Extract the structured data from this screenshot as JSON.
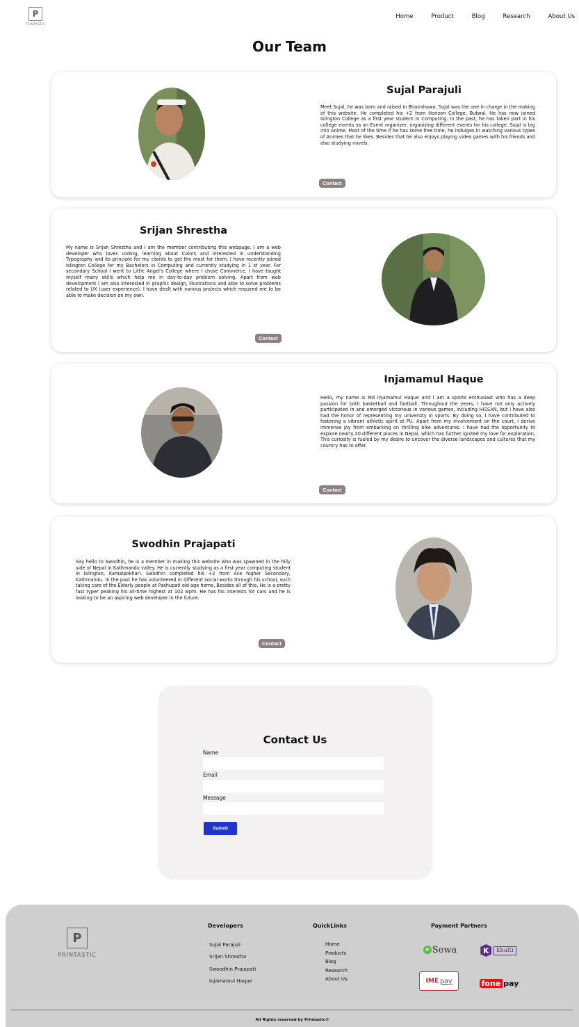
{
  "header": {
    "logo_text": "PRINTASTIC",
    "logo_mark": "P",
    "nav": [
      "Home",
      "Product",
      "Blog",
      "Research",
      "About Us"
    ]
  },
  "page_title": "Our Team",
  "team": [
    {
      "name": "Sujal Parajuli",
      "bio": "Meet Sujal, he was born and raised in Bhairahawa. Sujal was the one in charge in the making of this website. He completed his +2 from Horizon College, Butwal. He has now joined Islington College as a first year student in Computing. In the past, he has taken part in his college events as an Event organizer, organizing different events for his college. Sujal is big into Anime. Most of the time if he has some free time, he indulges in watching various types of Animes that he likes. Besides that he also enjoys playing video games with his friends and also studying novels.",
      "contact_label": "Contact"
    },
    {
      "name": "Srijan Shrestha",
      "bio": "My name is Srijan Shrestha and I am the member contributing this webpage. I am a web developer who loves coding, learning about Colors and interested in understanding Typography and its principle for my clients to get the most for them. I have recently joined Islington College for my Bachelors in Computing and currently studying in 1 st year. For secondary School I went to Little Angel's College where I chose Commerce. I have taught myself many skills which help me in day-to-day problem solving. Apart from web development I am also interested in graphic design, illustrations and able to solve problems related to UX (user experience). I have dealt with various projects which required me to be able to make decision on my own.",
      "contact_label": "Contact"
    },
    {
      "name": "Injamamul Haque",
      "bio": "Hello, my name is Md Injamamul Haque and I am a sports enthusiast who has a deep passion for both basketball and football. Throughout the years, I have not only actively participated in and emerged victorious in various games, including HISSAN, but I have also had the honor of representing my university in sports. By doing so, I have contributed to fostering a vibrant athletic spirit at PU. Apart from my involvement on the court, I derive immense joy from embarking on thrilling bike adventures. I have had the opportunity to explore nearly 20 different places in Nepal, which has further ignited my love for exploration. This curiosity is fueled by my desire to uncover the diverse landscapes and cultures that my country has to offer.",
      "contact_label": "Contact"
    },
    {
      "name": "Swodhin Prajapati",
      "bio": "Say hello to Swodhin, he is a member in making this website who was spawned in the hilly side of Nepal in Kathmandu valley. He is currently studying as a first year computing student in Islington, Kamalpokhari. Swodhin completed his +2 from Ace higher Secondary, Kathmandu. In the past he has volunteered in different social works through his school, such taking care of the Elderly people at Pashupati old age home. Besides all of this, He is a pretty fast typer peaking his all-time highest at 102 wpm. He has his interests for cars and he is looking to be an aspiring web developer in the future.",
      "contact_label": "Contact"
    }
  ],
  "contact": {
    "title": "Contact Us",
    "name_label": "Name",
    "email_label": "Email",
    "message_label": "Message",
    "submit_label": "Submit"
  },
  "footer": {
    "logo_text": "PRINTASTIC",
    "logo_mark": "P",
    "developers_heading": "Developers",
    "developers": [
      "Sujal Parajuli",
      "Srijan Shrestha",
      "Swoodhin Prajapati",
      "Injamamul Haque"
    ],
    "quicklinks_heading": "QuickLinks",
    "quicklinks": [
      "Home",
      "Products",
      "Blog",
      "Research",
      "About Us"
    ],
    "partners_heading": "Payment Partners",
    "partners": {
      "esewa": "Sewa",
      "esewa_mark": "e",
      "khalti": "khalti",
      "khalti_mark": "K",
      "imepay_ime": "IME",
      "imepay_pay": "pay",
      "fonepay_fone": "fone",
      "fonepay_pay": "pay"
    },
    "copyright": "All Rights reserved by Printastic©"
  },
  "colors": {
    "contact_button": "#8c7f7f",
    "submit_button": "#2036c8",
    "footer_bg": "#cfcfcf",
    "contact_panel_bg": "#f3f1f1"
  }
}
